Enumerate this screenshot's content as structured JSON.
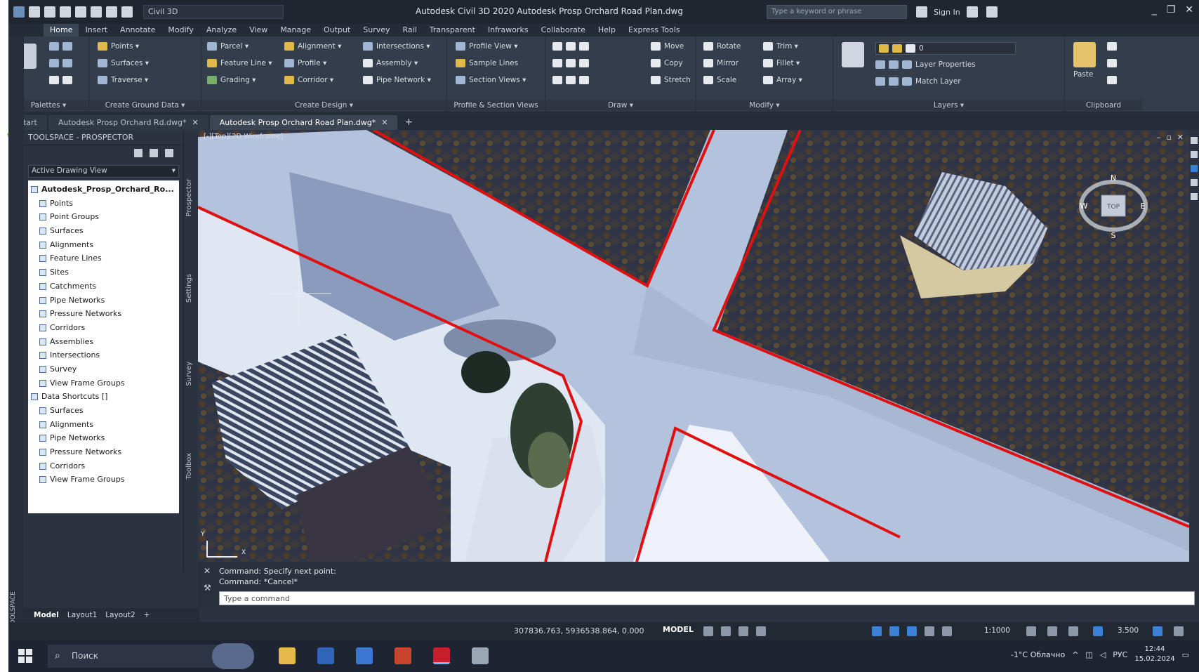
{
  "app": {
    "title": "Autodesk Civil 3D 2020   Autodesk Prosp Orchard Road Plan.dwg",
    "workspace": "Civil 3D",
    "search_placeholder": "Type a keyword or phrase",
    "user": "Sign In",
    "win_min": "_",
    "win_max": "❐",
    "win_close": "✕"
  },
  "menu_tabs": [
    "Home",
    "Insert",
    "Annotate",
    "Modify",
    "Analyze",
    "View",
    "Manage",
    "Output",
    "Survey",
    "Rail",
    "Transparent",
    "Infraworks",
    "Collaborate",
    "Help",
    "Express Tools"
  ],
  "ribbon": {
    "panels": [
      {
        "title": "Palettes ▾"
      },
      {
        "title": "Create Ground Data ▾"
      },
      {
        "title": "Create Design ▾"
      },
      {
        "title": "Profile & Section Views"
      },
      {
        "title": "Draw ▾"
      },
      {
        "title": "Modify ▾"
      },
      {
        "title": "Layers ▾"
      },
      {
        "title": "Clipboard"
      }
    ],
    "ground": [
      "Points ▾",
      "Surfaces ▾",
      "Traverse ▾"
    ],
    "design1": [
      "Parcel ▾",
      "Feature Line ▾",
      "Grading ▾"
    ],
    "design2": [
      "Alignment ▾",
      "Profile ▾",
      "Corridor ▾"
    ],
    "design3": [
      "Intersections ▾",
      "Assembly ▾",
      "Pipe Network ▾"
    ],
    "profile": [
      "Profile View ▾",
      "Sample Lines",
      "Section Views ▾"
    ],
    "modify1": [
      "Move",
      "Copy",
      "Stretch"
    ],
    "modify2": [
      "Rotate",
      "Mirror",
      "Scale"
    ],
    "modify3": [
      "Trim ▾",
      "Fillet ▾",
      "Array ▾"
    ],
    "layers": [
      "Layer Properties",
      "Match Layer"
    ],
    "layer_value": "0",
    "clipboard": "Paste"
  },
  "doc_tabs": [
    {
      "label": "Start"
    },
    {
      "label": "Autodesk Prosp Orchard Rd.dwg*",
      "close": "✕"
    },
    {
      "label": "Autodesk Prosp Orchard Road Plan.dwg*",
      "close": "✕"
    }
  ],
  "doc_tab_plus": "+",
  "prospector": {
    "title": "TOOLSPACE - PROSPECTOR",
    "combo": "Active Drawing View",
    "combo_chev": "▾",
    "tree": [
      {
        "label": "Autodesk_Prosp_Orchard_Ro..."
      },
      {
        "label": "Points"
      },
      {
        "label": "Point Groups"
      },
      {
        "label": "Surfaces"
      },
      {
        "label": "Alignments"
      },
      {
        "label": "Feature Lines"
      },
      {
        "label": "Sites"
      },
      {
        "label": "Catchments"
      },
      {
        "label": "Pipe Networks"
      },
      {
        "label": "Pressure Networks"
      },
      {
        "label": "Corridors"
      },
      {
        "label": "Assemblies"
      },
      {
        "label": "Intersections"
      },
      {
        "label": "Survey"
      },
      {
        "label": "View Frame Groups"
      },
      {
        "label": "Data Shortcuts []"
      },
      {
        "label": "Surfaces"
      },
      {
        "label": "Alignments"
      },
      {
        "label": "Pipe Networks"
      },
      {
        "label": "Pressure Networks"
      },
      {
        "label": "Corridors"
      },
      {
        "label": "View Frame Groups"
      }
    ]
  },
  "side_tabs": [
    "Prospector",
    "Settings",
    "Survey",
    "Toolbox"
  ],
  "palette_label": "TOOLSPACE",
  "viewport": {
    "label": "[-][Top][2D Wireframe]",
    "ctrl_min": "–",
    "ctrl_max": "▫",
    "ctrl_close": "✕",
    "cube_n": "N",
    "cube_w": "W",
    "cube_e": "E",
    "cube_s": "S",
    "cube_face": "TOP",
    "ucs_x": "X",
    "ucs_y": "Y"
  },
  "command": {
    "line1": "Command:  Specify next point:",
    "line2": "Command:  *Cancel*",
    "prompt": "Type a command"
  },
  "layout_tabs": [
    "Model",
    "Layout1",
    "Layout2",
    "+"
  ],
  "status": {
    "coords": "307836.763, 5936538.864, 0.000",
    "model": "MODEL",
    "scale": "1:1000",
    "scale2": "3.500"
  },
  "taskbar": {
    "search": "Поиск",
    "weather": "-1°C  Облачно",
    "time": "12:44",
    "date": "15.02.2024",
    "lang": "РУС"
  },
  "colors": {
    "parcel_line": "#e01010",
    "accent": "#3b82d6"
  }
}
